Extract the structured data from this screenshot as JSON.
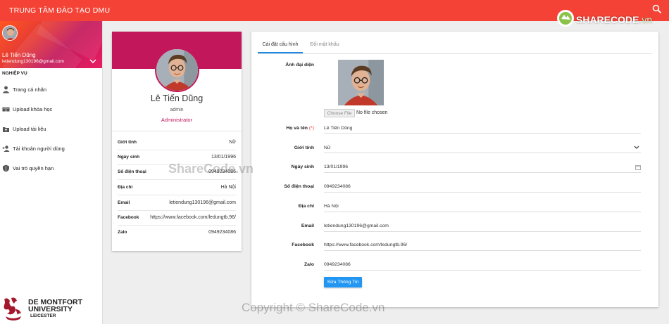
{
  "header": {
    "app_title": "TRUNG TÂM ĐÀO TẠO DMU",
    "logo_text": "SHARECODE",
    "logo_suffix": ".vn",
    "search_icon": "search-icon"
  },
  "sidebar": {
    "user_name": "Lê Tiến Dũng",
    "user_email": "letiendung130196@gmail.com",
    "section_label": "NGHIỆP VỤ",
    "items": [
      {
        "label": "Trang cá nhân",
        "icon": "person-icon"
      },
      {
        "label": "Upload khóa học",
        "icon": "book-icon"
      },
      {
        "label": "Upload tài liệu",
        "icon": "upload-icon"
      },
      {
        "label": "Tài khoản người dùng",
        "icon": "user-add-icon"
      },
      {
        "label": "Vai trò quyền hạn",
        "icon": "shield-icon"
      }
    ],
    "university": {
      "line1": "DE MONTFORT",
      "line2": "UNIVERSITY",
      "line3": "LEICESTER"
    }
  },
  "profile_card": {
    "name": "Lê Tiến Dũng",
    "username": "admin",
    "role": "Administrator",
    "rows": [
      {
        "label": "Giới tính",
        "value": "Nữ"
      },
      {
        "label": "Ngày sinh",
        "value": "13/01/1996"
      },
      {
        "label": "Số điện thoại",
        "value": "0949234086"
      },
      {
        "label": "Địa chỉ",
        "value": "Hà Nội"
      },
      {
        "label": "Email",
        "value": "letiendung130196@gmail.com"
      },
      {
        "label": "Facebook",
        "value": "https://www.facebook.com/ledungtb.96/"
      },
      {
        "label": "Zalo",
        "value": "0949234086"
      }
    ]
  },
  "settings": {
    "tabs": [
      "Cài đặt cấu hình",
      "Đổi mật khẩu"
    ],
    "avatar_label": "Ảnh đại diện",
    "choose_file": "Choose File",
    "no_file": "No file chosen",
    "fields": [
      {
        "label": "Họ và tên",
        "required": "(*)",
        "value": "Lê Tiến Dũng"
      },
      {
        "label": "Giới tính",
        "value": "Nữ"
      },
      {
        "label": "Ngày sinh",
        "value": "13/01/1996"
      },
      {
        "label": "Số điện thoại",
        "value": "0949234086"
      },
      {
        "label": "Địa chỉ",
        "value": "Hà Nội"
      },
      {
        "label": "Email",
        "value": "letiendung130196@gmail.com"
      },
      {
        "label": "Facebook",
        "value": "https://www.facebook.com/ledungtb.96/"
      },
      {
        "label": "Zalo",
        "value": "0949234086"
      }
    ],
    "submit_label": "Sửa Thông Tin"
  },
  "watermarks": {
    "center": "ShareCode.vn",
    "bottom": "Copyright © ShareCode.vn"
  },
  "colors": {
    "header": "#f44336",
    "accent": "#c2185b",
    "button": "#2196f3"
  }
}
